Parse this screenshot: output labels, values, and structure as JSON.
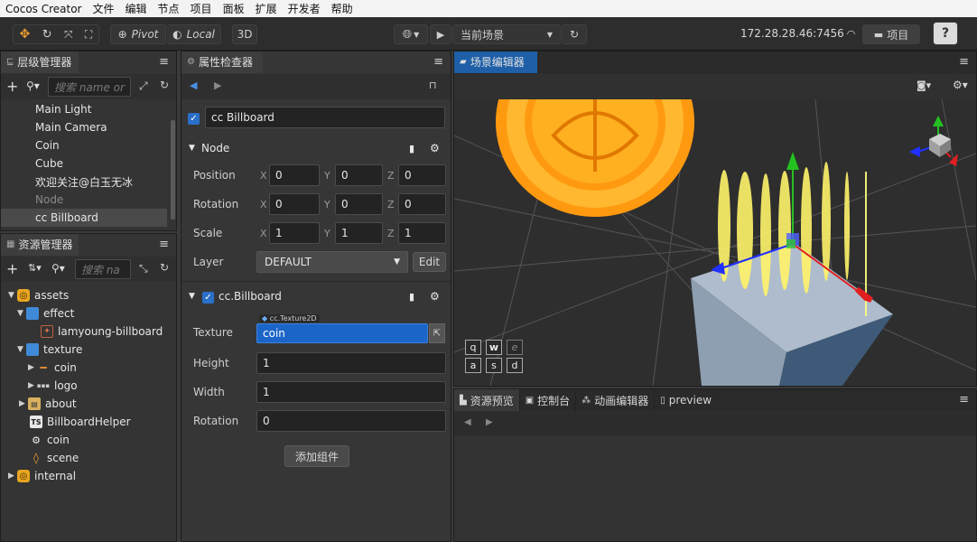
{
  "menubar": {
    "items": [
      "Cocos Creator",
      "文件",
      "编辑",
      "节点",
      "项目",
      "面板",
      "扩展",
      "开发者",
      "帮助"
    ]
  },
  "toolbar": {
    "pivot": "Pivot",
    "local": "Local",
    "mode3d": "3D",
    "scene_select": "当前场景",
    "ip": "172.28.28.46:7456",
    "project_button": "项目",
    "help": "?"
  },
  "hierarchy": {
    "title": "层级管理器",
    "search_placeholder": "搜索 name or",
    "items": [
      {
        "label": "Main Light"
      },
      {
        "label": "Main Camera"
      },
      {
        "label": "Coin"
      },
      {
        "label": "Cube"
      },
      {
        "label": "欢迎关注@白玉无冰"
      },
      {
        "label": "Node"
      },
      {
        "label": "cc Billboard"
      }
    ]
  },
  "assets": {
    "title": "资源管理器",
    "search_placeholder": "搜索 na",
    "items": [
      {
        "label": "assets"
      },
      {
        "label": "effect"
      },
      {
        "label": "lamyoung-billboard"
      },
      {
        "label": "texture"
      },
      {
        "label": "coin"
      },
      {
        "label": "logo"
      },
      {
        "label": "about"
      },
      {
        "label": "BillboardHelper"
      },
      {
        "label": "coin"
      },
      {
        "label": "scene"
      },
      {
        "label": "internal"
      }
    ],
    "ts_badge": "TS"
  },
  "inspector": {
    "title": "属性检查器",
    "node_name": "cc Billboard",
    "node_section": "Node",
    "position": {
      "label": "Position",
      "x": "0",
      "y": "0",
      "z": "0"
    },
    "rotation": {
      "label": "Rotation",
      "x": "0",
      "y": "0",
      "z": "0"
    },
    "scale": {
      "label": "Scale",
      "x": "1",
      "y": "1",
      "z": "1"
    },
    "axis": {
      "x": "X",
      "y": "Y",
      "z": "Z"
    },
    "layer": {
      "label": "Layer",
      "value": "DEFAULT",
      "edit": "Edit"
    },
    "component": {
      "title": "cc.Billboard",
      "texture_type": "cc.Texture2D",
      "texture_label": "Texture",
      "texture_value": "coin",
      "height_label": "Height",
      "height_value": "1",
      "width_label": "Width",
      "width_value": "1",
      "rotation_label": "Rotation",
      "rotation_value": "0"
    },
    "add_component": "添加组件"
  },
  "scene": {
    "title": "场景编辑器",
    "keys": [
      "q",
      "w",
      "e",
      "a",
      "s",
      "d"
    ]
  },
  "bottom": {
    "tabs": [
      "资源预览",
      "控制台",
      "动画编辑器",
      "preview"
    ]
  },
  "colors": {
    "accent": "#2a6fc9",
    "selected_tab": "#1e5fa8"
  }
}
